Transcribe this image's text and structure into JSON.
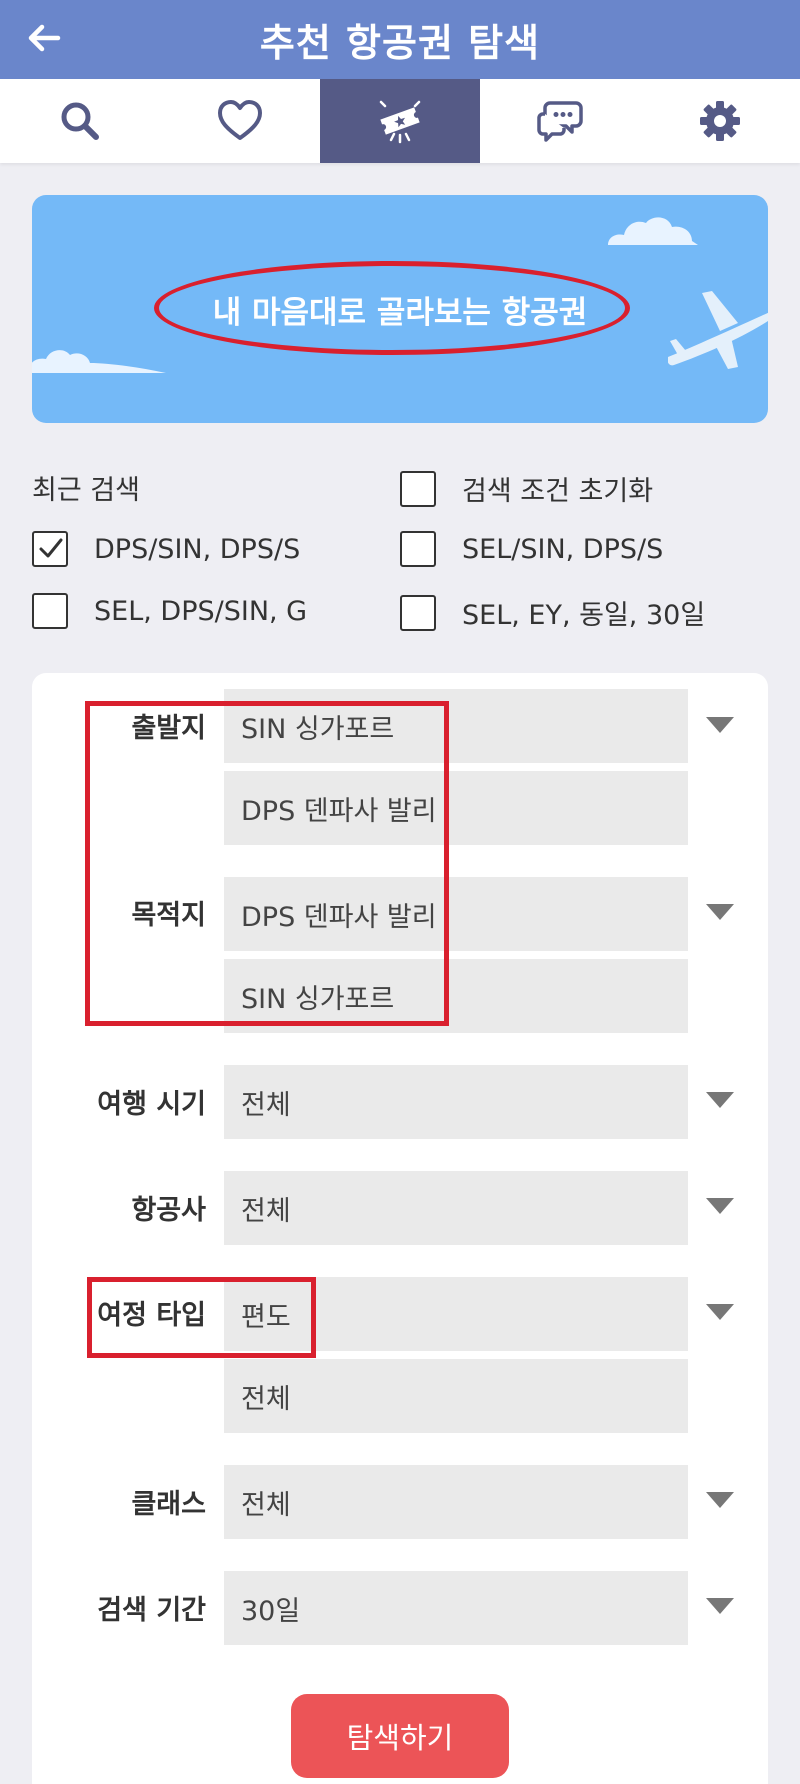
{
  "header": {
    "title": "추천 항공권 탐색"
  },
  "tabs": [
    {
      "icon": "search-icon"
    },
    {
      "icon": "heart-icon"
    },
    {
      "icon": "ticket-icon",
      "active": true
    },
    {
      "icon": "chat-icon"
    },
    {
      "icon": "gear-icon"
    }
  ],
  "banner": {
    "title": "내 마음대로 골라보는 항공권"
  },
  "recent": {
    "label": "최근 검색",
    "reset_label": "검색 조건 초기화",
    "items": [
      {
        "label": "DPS/SIN, DPS/S",
        "checked": true
      },
      {
        "label": "SEL/SIN, DPS/S",
        "checked": false
      },
      {
        "label": "SEL, DPS/SIN, G",
        "checked": false
      },
      {
        "label": "SEL, EY, 동일, 30일",
        "checked": false
      }
    ]
  },
  "form": {
    "origin": {
      "label": "출발지",
      "values": [
        "SIN 싱가포르",
        "DPS 덴파사 발리"
      ]
    },
    "destination": {
      "label": "목적지",
      "values": [
        "DPS 덴파사 발리",
        "SIN 싱가포르"
      ]
    },
    "travel_period": {
      "label": "여행 시기",
      "value": "전체"
    },
    "airline": {
      "label": "항공사",
      "value": "전체"
    },
    "trip_type": {
      "label": "여정 타입",
      "values": [
        "편도",
        "전체"
      ]
    },
    "class": {
      "label": "클래스",
      "value": "전체"
    },
    "search_period": {
      "label": "검색 기간",
      "value": "30일"
    }
  },
  "search_button": {
    "label": "탐색하기"
  },
  "colors": {
    "header": "#6a86cb",
    "active_tab": "#555a86",
    "banner": "#74b9f7",
    "highlight": "#d9202e",
    "search_button": "#ec5457"
  }
}
